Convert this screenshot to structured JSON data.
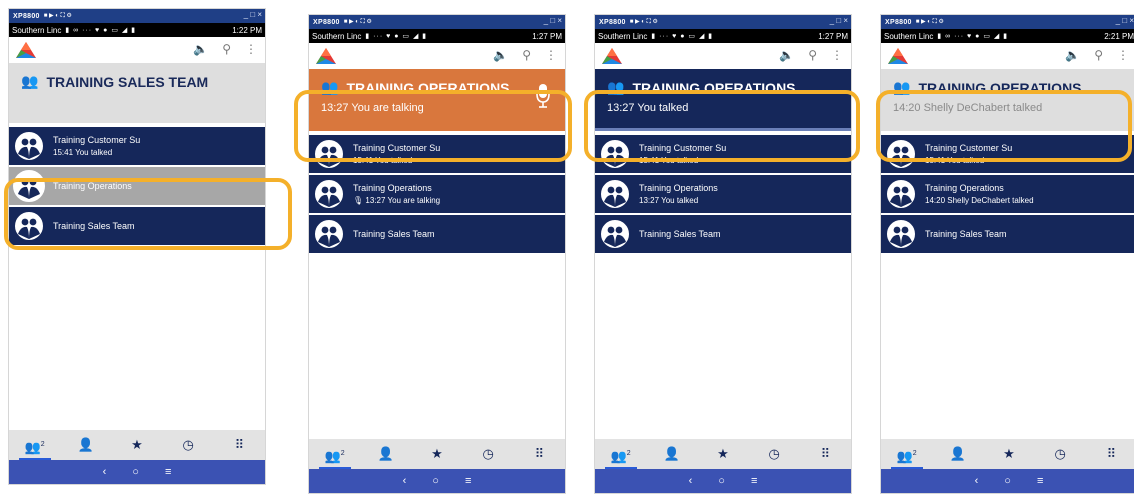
{
  "colors": {
    "navy": "#15275a",
    "orange": "#d9773d",
    "highlight": "#f4b02a",
    "nav": "#3b52b3"
  },
  "window": {
    "device": "XP8800",
    "controls": "_ □ ×"
  },
  "carrier": "Southern Linc",
  "screens": [
    {
      "time": "1:22 PM",
      "header_title": "TRAINING SALES TEAM",
      "header_sub": "",
      "rows": [
        {
          "name": "Training Customer Su",
          "sub": "15:41 You talked"
        },
        {
          "name": "Training Operations",
          "sub": ""
        },
        {
          "name": "Training Sales Team",
          "sub": ""
        }
      ]
    },
    {
      "time": "1:27 PM",
      "header_title": "TRAINING OPERATIONS",
      "header_sub": "13:27 You are talking",
      "rows": [
        {
          "name": "Training Customer Su",
          "sub": "15:41 You talked"
        },
        {
          "name": "Training Operations",
          "sub": "13:27 You are talking"
        },
        {
          "name": "Training Sales Team",
          "sub": ""
        }
      ]
    },
    {
      "time": "1:27 PM",
      "header_title": "TRAINING OPERATIONS",
      "header_sub": "13:27 You talked",
      "rows": [
        {
          "name": "Training Customer Su",
          "sub": "15:41 You talked"
        },
        {
          "name": "Training Operations",
          "sub": "13:27 You talked"
        },
        {
          "name": "Training Sales Team",
          "sub": ""
        }
      ]
    },
    {
      "time": "2:21 PM",
      "header_title": "TRAINING OPERATIONS",
      "header_sub": "14:20 Shelly DeChabert talked",
      "rows": [
        {
          "name": "Training Customer Su",
          "sub": "15:41 You talked"
        },
        {
          "name": "Training Operations",
          "sub": "14:20 Shelly DeChabert talked"
        },
        {
          "name": "Training Sales Team",
          "sub": ""
        }
      ]
    }
  ],
  "icons": {
    "speaker": "speaker-icon",
    "search": "search-icon",
    "more": "more-vert-icon",
    "groups": "groups-icon",
    "contacts": "person-icon",
    "favorites": "star-icon",
    "history": "clock-icon",
    "dialpad": "dialpad-icon",
    "mic": "mic-icon",
    "back": "back-icon",
    "home": "home-icon",
    "menu": "menu-icon"
  },
  "tabbar": {
    "groups_badge": "2"
  }
}
